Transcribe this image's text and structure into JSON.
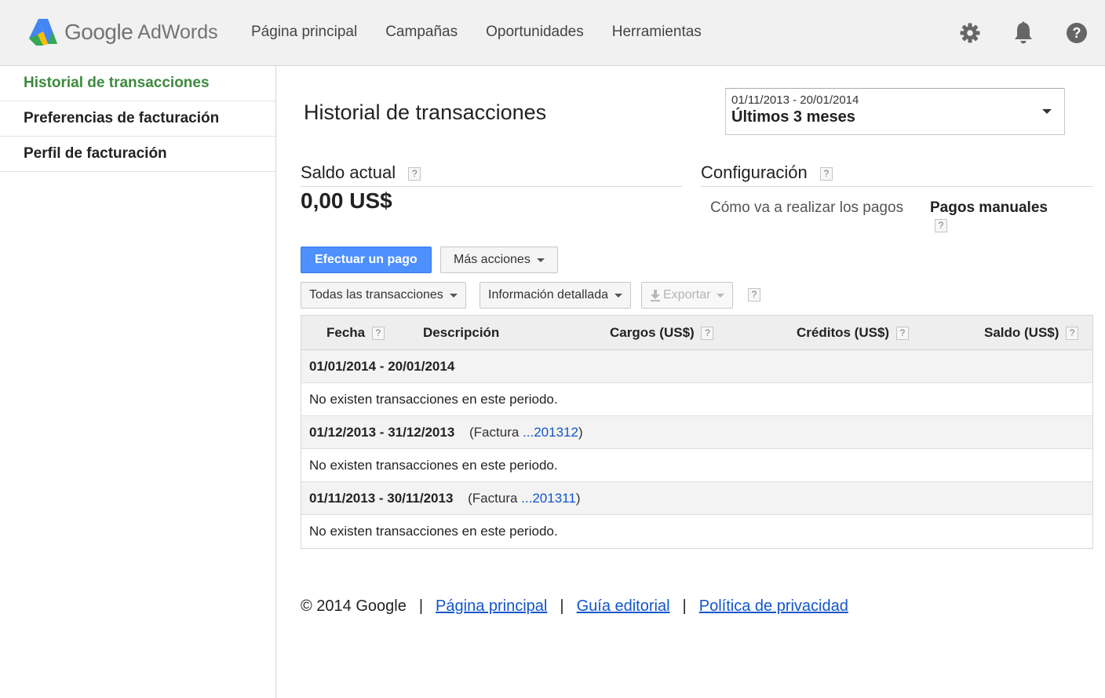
{
  "header": {
    "logo_google": "Google",
    "logo_adwords": "AdWords",
    "nav": [
      "Página principal",
      "Campañas",
      "Oportunidades",
      "Herramientas"
    ],
    "icons": [
      "gear-icon",
      "bell-icon",
      "help-icon"
    ]
  },
  "sidebar": {
    "items": [
      {
        "label": "Historial de transacciones",
        "active": true
      },
      {
        "label": "Preferencias de facturación",
        "active": false
      },
      {
        "label": "Perfil de facturación",
        "active": false
      }
    ]
  },
  "main": {
    "title": "Historial de transacciones",
    "date_range": {
      "range": "01/11/2013 - 20/01/2014",
      "label": "Últimos 3 meses"
    },
    "balance": {
      "heading": "Saldo actual",
      "value": "0,00 US$"
    },
    "config": {
      "heading": "Configuración",
      "label": "Cómo va a realizar los pagos",
      "value": "Pagos manuales"
    },
    "help_glyph": "?",
    "buttons": {
      "pay": "Efectuar un pago",
      "more": "Más acciones",
      "filter": "Todas las transacciones",
      "detail": "Información detallada",
      "export": "Exportar"
    },
    "table": {
      "headers": [
        "Fecha",
        "Descripción",
        "Cargos (US$)",
        "Créditos (US$)",
        "Saldo (US$)"
      ],
      "periods": [
        {
          "range": "01/01/2014 - 20/01/2014",
          "inv_prefix": "",
          "inv_link": "",
          "inv_suffix": "",
          "empty": "No existen transacciones en este periodo."
        },
        {
          "range": "01/12/2013 - 31/12/2013",
          "inv_prefix": "(Factura ",
          "inv_link": "...201312",
          "inv_suffix": ")",
          "empty": "No existen transacciones en este periodo."
        },
        {
          "range": "01/11/2013 - 30/11/2013",
          "inv_prefix": "(Factura ",
          "inv_link": "...201311",
          "inv_suffix": ")",
          "empty": "No existen transacciones en este periodo."
        }
      ]
    }
  },
  "footer": {
    "copyright": "© 2014 Google",
    "separator": "|",
    "links": [
      "Página principal",
      "Guía editorial",
      "Política de privacidad"
    ]
  },
  "colors": {
    "active_sidebar": "#3d8a3d",
    "primary_button": "#4d90fe",
    "link": "#1155cc"
  }
}
